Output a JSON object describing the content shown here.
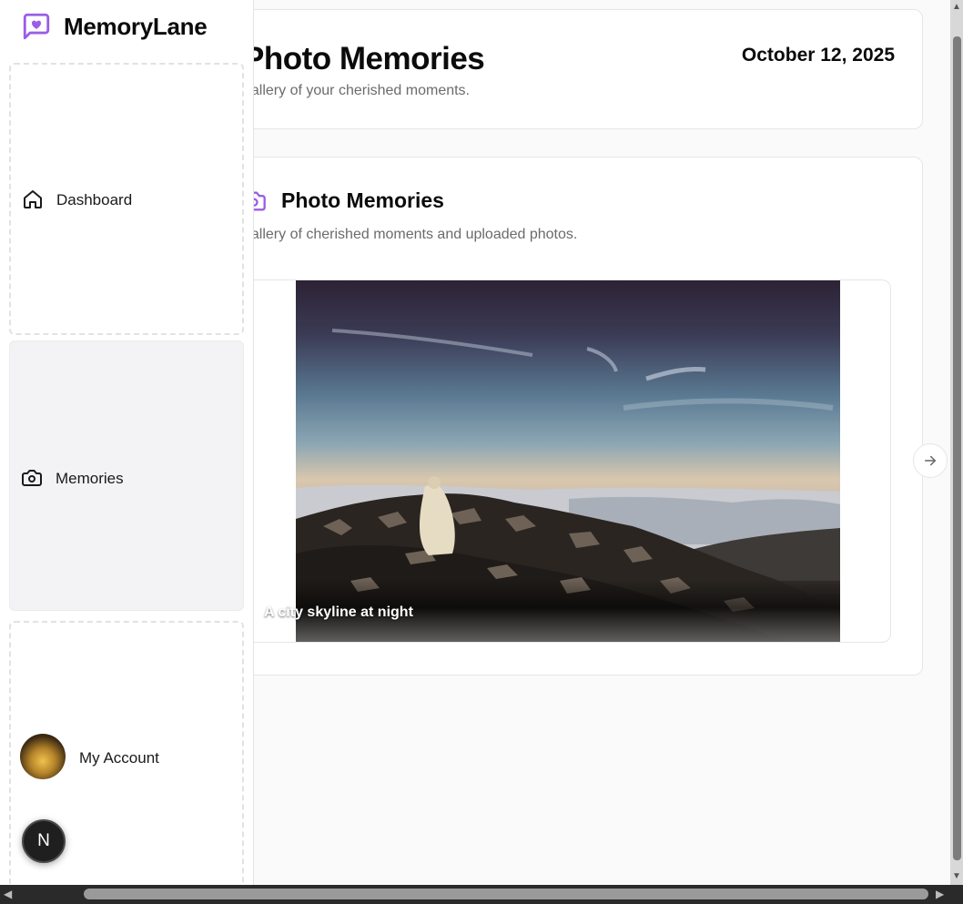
{
  "brand": {
    "name": "MemoryLane",
    "accent": "#9b5de5"
  },
  "sidebar": {
    "items": [
      {
        "label": "Dashboard",
        "icon": "home-icon"
      },
      {
        "label": "Memories",
        "icon": "camera-icon",
        "active": true
      },
      {
        "label": "My Account",
        "icon": "avatar"
      }
    ]
  },
  "header": {
    "title": "Photo Memories",
    "subtitle": "gallery of your cherished moments.",
    "date": "October 12, 2025"
  },
  "gallery": {
    "title": "Photo Memories",
    "subtitle": "gallery of cherished moments and uploaded photos.",
    "icon": "camera-icon",
    "slide_caption": "A city skyline at night",
    "next_icon": "arrow-right-icon"
  },
  "badge": {
    "label": "N"
  }
}
